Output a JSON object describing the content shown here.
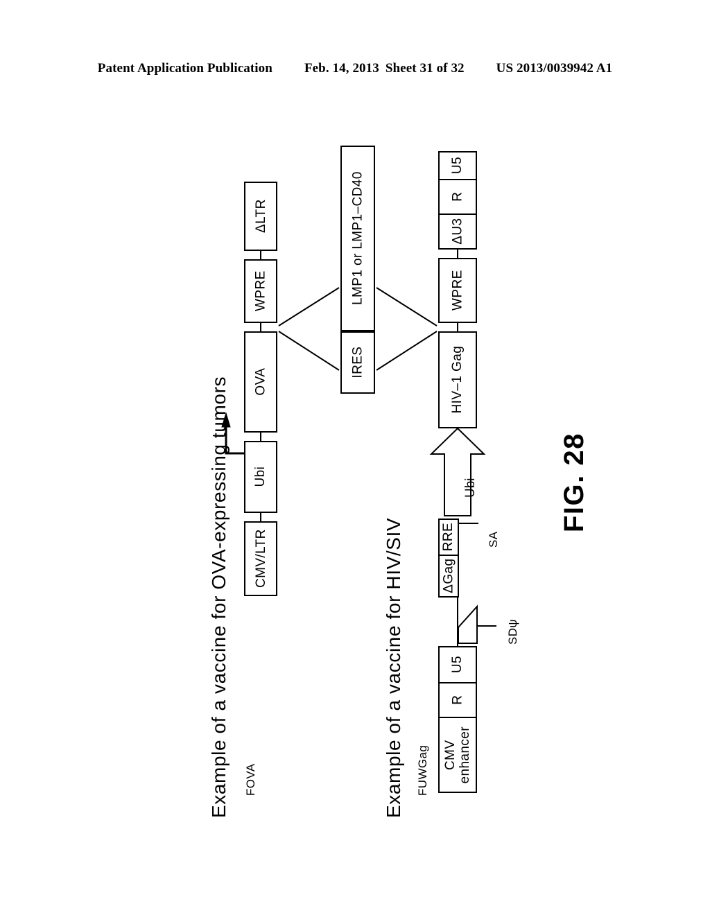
{
  "header": {
    "publication": "Patent Application Publication",
    "date": "Feb. 14, 2013",
    "sheet": "Sheet 31 of 32",
    "number": "US 2013/0039942 A1"
  },
  "figure": {
    "label": "FIG. 28"
  },
  "constructs": [
    {
      "id": "fova",
      "name": "FOVA",
      "caption": "Example of a vaccine for OVA-expressing tumors",
      "segments": [
        {
          "key": "cmv_ltr",
          "label": "CMV/LTR"
        },
        {
          "key": "ubi",
          "label": "Ubi"
        },
        {
          "key": "ova",
          "label": "OVA"
        },
        {
          "key": "wpre",
          "label": "WPRE"
        },
        {
          "key": "dltr",
          "label": "ΔLTR"
        }
      ]
    },
    {
      "id": "insert",
      "segments": [
        {
          "key": "ires",
          "label": "IRES"
        },
        {
          "key": "lmp1",
          "label": "LMP1 or LMP1–CD40"
        }
      ]
    },
    {
      "id": "fuwgag",
      "name": "FUWGag",
      "caption": "Example of a vaccine for HIV/SIV",
      "segments": [
        {
          "key": "cmv_enhancer",
          "label": "CMV\nenhancer"
        },
        {
          "key": "r5",
          "label": "R"
        },
        {
          "key": "u5_5",
          "label": "U5"
        },
        {
          "key": "sd_psi",
          "label": "SDψ"
        },
        {
          "key": "dgag",
          "label": "ΔGag"
        },
        {
          "key": "rre",
          "label": "RRE"
        },
        {
          "key": "sa",
          "label": "SA"
        },
        {
          "key": "ubi",
          "label": "Ubi"
        },
        {
          "key": "hiv1_gag",
          "label": "HIV–1 Gag"
        },
        {
          "key": "wpre",
          "label": "WPRE"
        },
        {
          "key": "du3",
          "label": "ΔU3"
        },
        {
          "key": "r3",
          "label": "R"
        },
        {
          "key": "u5_3",
          "label": "U5"
        }
      ]
    }
  ]
}
